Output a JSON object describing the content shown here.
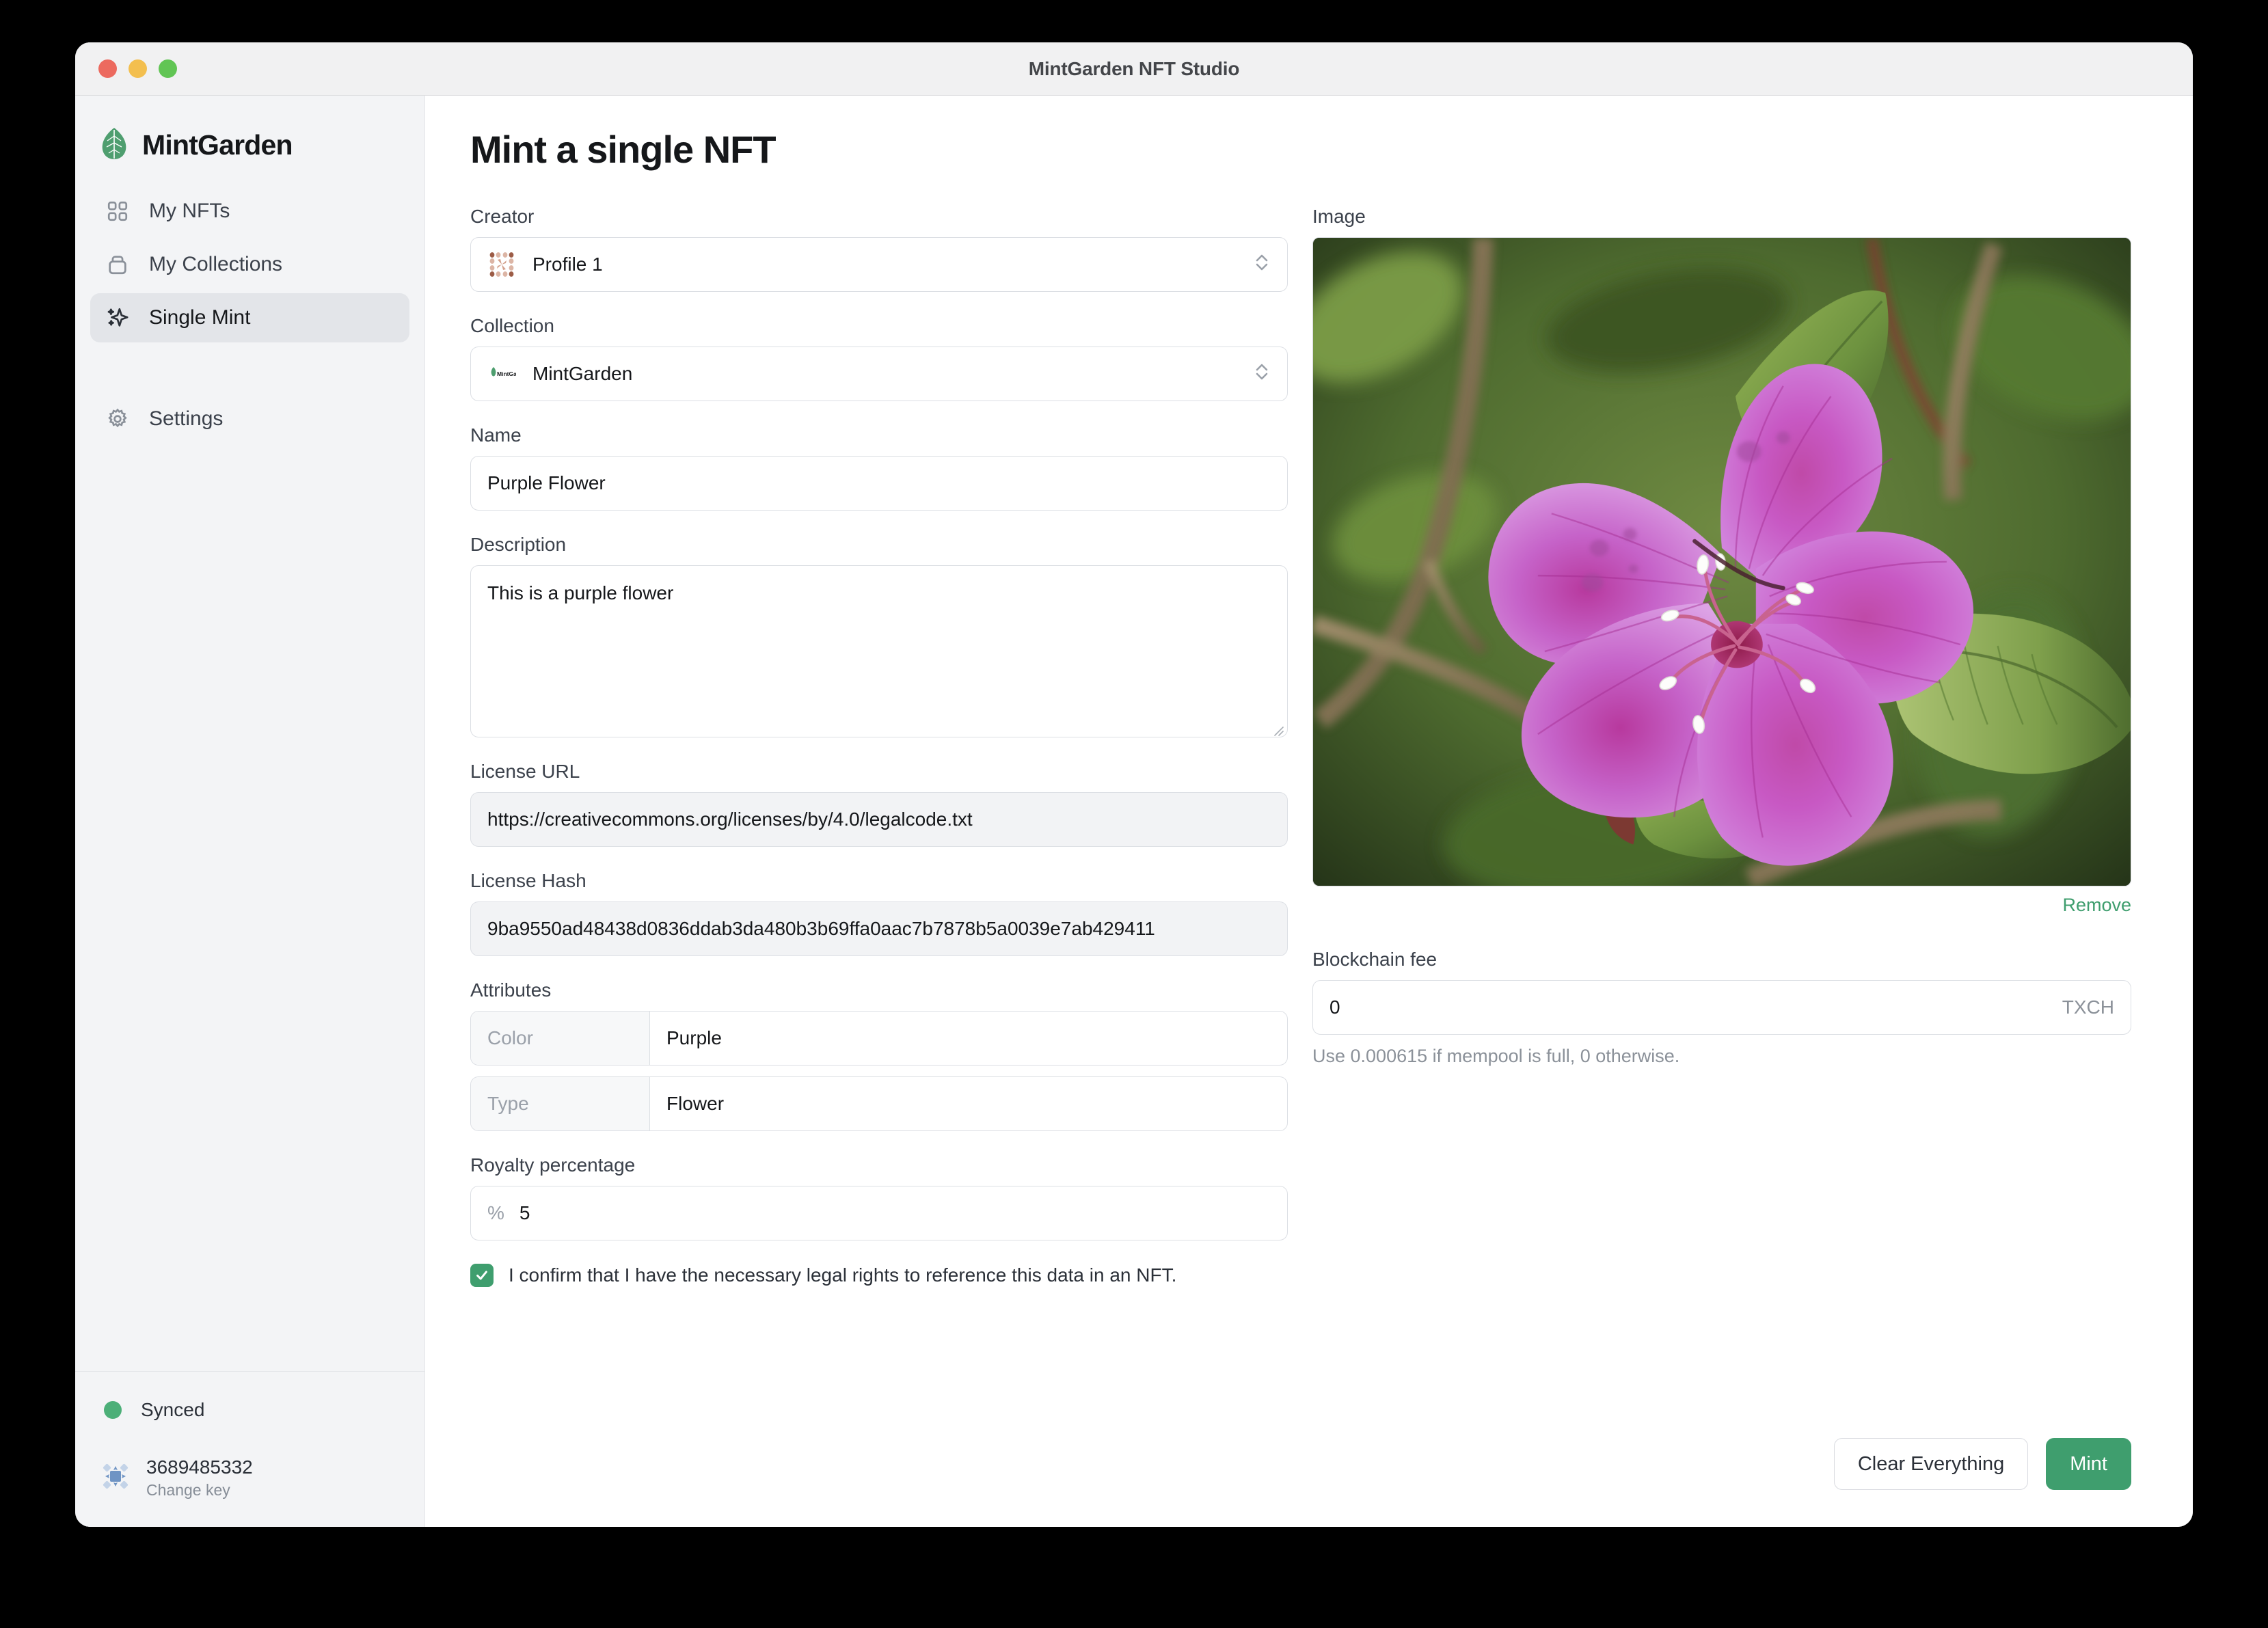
{
  "window": {
    "title": "MintGarden NFT Studio",
    "traffic_lights": [
      "close",
      "minimize",
      "zoom"
    ]
  },
  "sidebar": {
    "brand": "MintGarden",
    "items": [
      {
        "label": "My NFTs",
        "icon": "grid-icon",
        "active": false
      },
      {
        "label": "My Collections",
        "icon": "archive-icon",
        "active": false
      },
      {
        "label": "Single Mint",
        "icon": "sparkles-icon",
        "active": true
      },
      {
        "label": "Settings",
        "icon": "gear-icon",
        "active": false
      }
    ],
    "status": {
      "sync_label": "Synced",
      "sync_color": "#4caf78",
      "key_id": "3689485332",
      "key_action": "Change key"
    }
  },
  "main": {
    "page_title": "Mint a single NFT",
    "creator": {
      "label": "Creator",
      "value": "Profile 1",
      "icon": "identicon-avatar"
    },
    "collection": {
      "label": "Collection",
      "value": "MintGarden",
      "icon": "mintgarden-thumb"
    },
    "name": {
      "label": "Name",
      "value": "Purple Flower",
      "placeholder": "Name"
    },
    "description": {
      "label": "Description",
      "value": "This is a purple flower",
      "placeholder": "Description"
    },
    "license_url": {
      "label": "License URL",
      "value": "https://creativecommons.org/licenses/by/4.0/legalcode.txt"
    },
    "license_hash": {
      "label": "License Hash",
      "value": "9ba9550ad48438d0836ddab3da480b3b69ffa0aac7b7878b5a0039e7ab429411"
    },
    "attributes": {
      "label": "Attributes",
      "rows": [
        {
          "key": "Color",
          "value": "Purple"
        },
        {
          "key": "Type",
          "value": "Flower"
        }
      ]
    },
    "royalty": {
      "label": "Royalty percentage",
      "prefix": "%",
      "value": "5"
    },
    "confirm": {
      "checked": true,
      "text": "I confirm that I have the necessary legal rights to reference this data in an NFT."
    }
  },
  "right": {
    "image": {
      "label": "Image",
      "remove_label": "Remove",
      "alt": "purple flower photograph"
    },
    "fee": {
      "label": "Blockchain fee",
      "value": "0",
      "unit": "TXCH",
      "hint": "Use 0.000615 if mempool is full, 0 otherwise."
    }
  },
  "actions": {
    "clear_label": "Clear Everything",
    "mint_label": "Mint"
  },
  "colors": {
    "accent_green": "#3f9e6e",
    "sidebar_bg": "#f3f4f6",
    "active_item": "#e3e5e9"
  }
}
